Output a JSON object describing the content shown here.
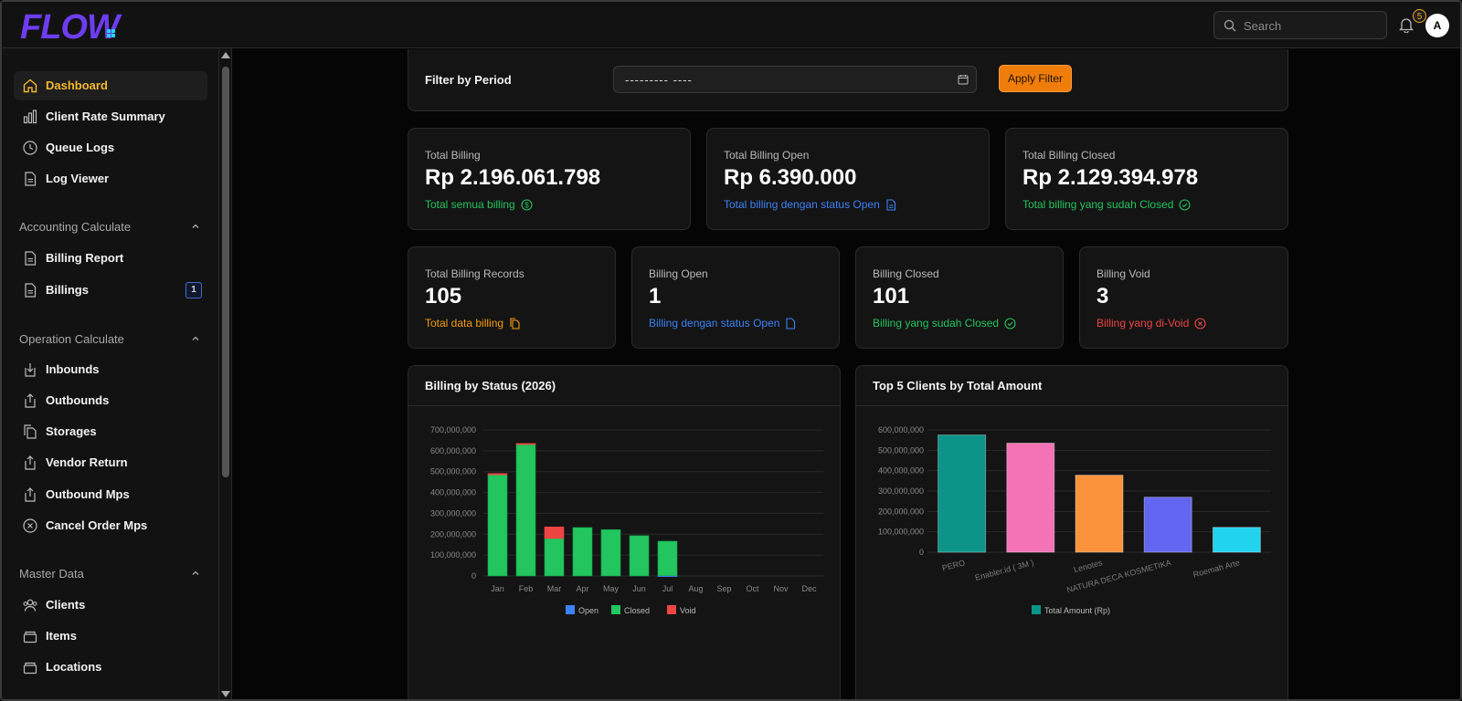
{
  "header": {
    "logo_text": "FLOW",
    "search_placeholder": "Search",
    "notification_count": "5",
    "avatar_initial": "A"
  },
  "sidebar": {
    "items_top": [
      {
        "label": "Dashboard",
        "icon": "home-icon",
        "active": true
      },
      {
        "label": "Client Rate Summary",
        "icon": "bar-chart-icon"
      },
      {
        "label": "Queue Logs",
        "icon": "clock-icon"
      },
      {
        "label": "Log Viewer",
        "icon": "file-icon"
      }
    ],
    "sections": [
      {
        "title": "Accounting Calculate",
        "items": [
          {
            "label": "Billing Report",
            "icon": "file-icon"
          },
          {
            "label": "Billings",
            "icon": "file-icon",
            "badge": "1"
          }
        ]
      },
      {
        "title": "Operation Calculate",
        "items": [
          {
            "label": "Inbounds",
            "icon": "download-icon"
          },
          {
            "label": "Outbounds",
            "icon": "upload-icon"
          },
          {
            "label": "Storages",
            "icon": "copy-icon"
          },
          {
            "label": "Vendor Return",
            "icon": "upload-icon"
          },
          {
            "label": "Outbound Mps",
            "icon": "upload-icon"
          },
          {
            "label": "Cancel Order Mps",
            "icon": "x-circle-icon"
          }
        ]
      },
      {
        "title": "Master Data",
        "items": [
          {
            "label": "Clients",
            "icon": "users-icon"
          },
          {
            "label": "Items",
            "icon": "box-icon"
          },
          {
            "label": "Locations",
            "icon": "box-icon"
          }
        ]
      }
    ]
  },
  "filter": {
    "label": "Filter by Period",
    "date_value": "--------- ----",
    "apply_label": "Apply Filter"
  },
  "stats_row1": [
    {
      "title": "Total Billing",
      "value": "Rp 2.196.061.798",
      "sub": "Total semua billing",
      "color": "#22c55e",
      "icon": "dollar-circle-icon"
    },
    {
      "title": "Total Billing Open",
      "value": "Rp 6.390.000",
      "sub": "Total billing dengan status Open",
      "color": "#3b82f6",
      "icon": "file-icon"
    },
    {
      "title": "Total Billing Closed",
      "value": "Rp 2.129.394.978",
      "sub": "Total billing yang sudah Closed",
      "color": "#22c55e",
      "icon": "check-circle-icon"
    }
  ],
  "stats_row2": [
    {
      "title": "Total Billing Records",
      "value": "105",
      "sub": "Total data billing",
      "color": "#f59e0b",
      "icon": "copy-icon"
    },
    {
      "title": "Billing Open",
      "value": "1",
      "sub": "Billing dengan status Open",
      "color": "#3b82f6",
      "icon": "file-icon"
    },
    {
      "title": "Billing Closed",
      "value": "101",
      "sub": "Billing yang sudah Closed",
      "color": "#22c55e",
      "icon": "check-circle-icon"
    },
    {
      "title": "Billing Void",
      "value": "3",
      "sub": "Billing yang di-Void",
      "color": "#ef4444",
      "icon": "x-circle-icon"
    }
  ],
  "chart_data": [
    {
      "type": "bar",
      "stacked": true,
      "title": "Billing by Status (2026)",
      "categories": [
        "Jan",
        "Feb",
        "Mar",
        "Apr",
        "May",
        "Jun",
        "Jul",
        "Aug",
        "Sep",
        "Oct",
        "Nov",
        "Dec"
      ],
      "series": [
        {
          "name": "Open",
          "color": "#3b82f6",
          "values": [
            0,
            0,
            0,
            0,
            0,
            0,
            1500000,
            0,
            0,
            0,
            0,
            0
          ]
        },
        {
          "name": "Closed",
          "color": "#22c55e",
          "values": [
            485000000,
            630000000,
            180000000,
            232000000,
            222000000,
            193000000,
            165000000,
            0,
            0,
            0,
            0,
            0
          ]
        },
        {
          "name": "Void",
          "color": "#ef4444",
          "values": [
            6000000,
            5000000,
            55000000,
            0,
            0,
            0,
            0,
            0,
            0,
            0,
            0,
            0
          ]
        }
      ],
      "ylim": [
        0,
        700000000
      ],
      "yticks": [
        0,
        100000000,
        200000000,
        300000000,
        400000000,
        500000000,
        600000000,
        700000000
      ],
      "ytick_labels": [
        "0",
        "100,000,000",
        "200,000,000",
        "300,000,000",
        "400,000,000",
        "500,000,000",
        "600,000,000",
        "700,000,000"
      ],
      "legend": "bottom"
    },
    {
      "type": "bar",
      "title": "Top 5 Clients by Total Amount",
      "categories": [
        "PERO",
        "Enabler.id ( 3M )",
        "Lenotes",
        "NATURA DECA KOSMETIKA",
        "Roemah Arte"
      ],
      "series": [
        {
          "name": "Total Amount (Rp)",
          "values": [
            575000000,
            535000000,
            378000000,
            270000000,
            122000000
          ]
        }
      ],
      "colors": [
        "#0d9488",
        "#f472b6",
        "#fb923c",
        "#6366f1",
        "#22d3ee"
      ],
      "ylim": [
        0,
        600000000
      ],
      "yticks": [
        0,
        100000000,
        200000000,
        300000000,
        400000000,
        500000000,
        600000000
      ],
      "ytick_labels": [
        "0",
        "100,000,000",
        "200,000,000",
        "300,000,000",
        "400,000,000",
        "500,000,000",
        "600,000,000"
      ],
      "legend": "bottom"
    }
  ]
}
